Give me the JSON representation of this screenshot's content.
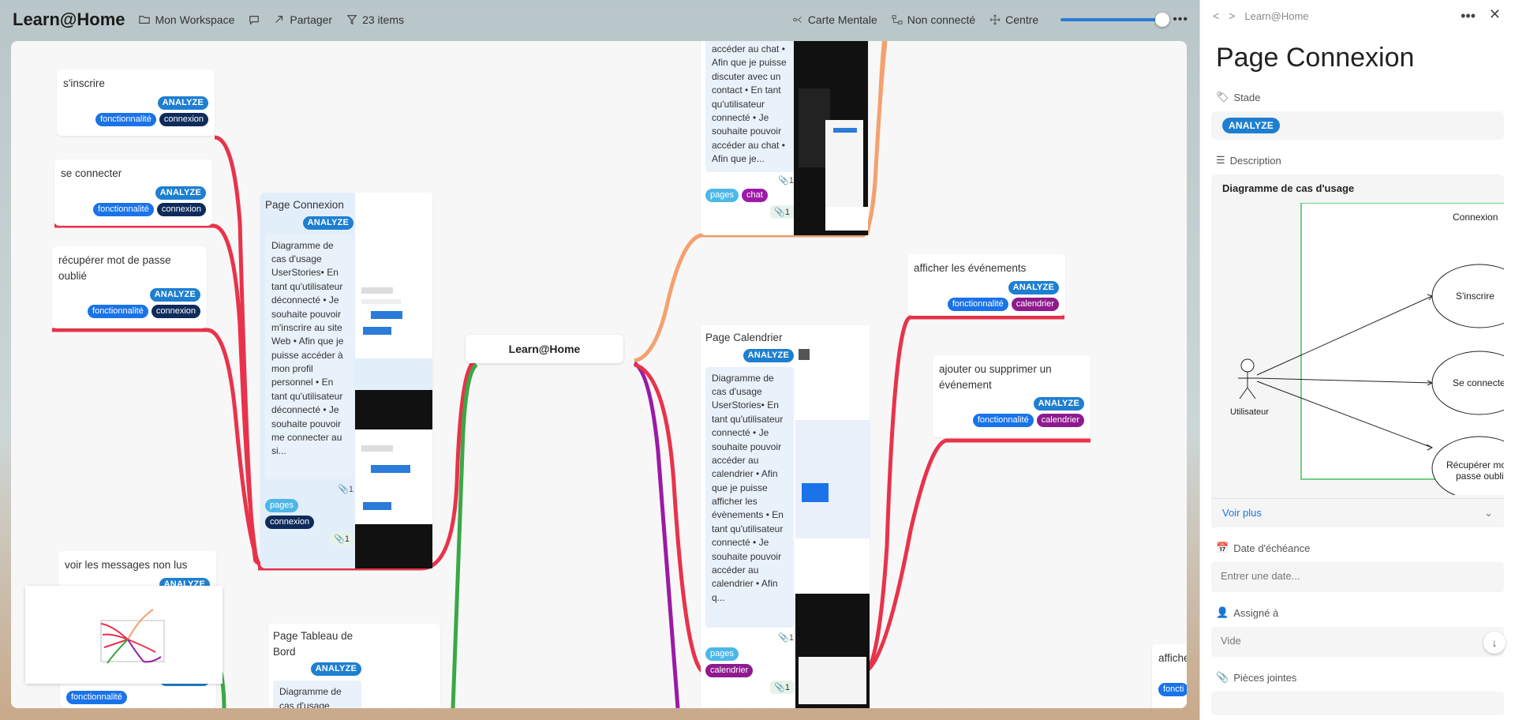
{
  "topbar": {
    "app_title": "Learn@Home",
    "workspace": "Mon Workspace",
    "share": "Partager",
    "items_count": "23 items",
    "view_mode": "Carte Mentale",
    "connection_status": "Non connecté",
    "center_label": "Centre",
    "zoom_level": 0.95
  },
  "mindmap": {
    "root": "Learn@Home",
    "nodes": {
      "inscrire": {
        "title": "s'inscrire",
        "stage": "ANALYZE",
        "tags": [
          "fonctionnalité",
          "connexion"
        ]
      },
      "connecter": {
        "title": "se connecter",
        "stage": "ANALYZE",
        "tags": [
          "fonctionnalité",
          "connexion"
        ]
      },
      "recuperer": {
        "title": "récupérer mot de passe oublié",
        "stage": "ANALYZE",
        "tags": [
          "fonctionnalité",
          "connexion"
        ]
      },
      "messages": {
        "title": "voir les messages non lus",
        "stage": "ANALYZE",
        "tags": [
          "fonctionnalité"
        ]
      },
      "page_connexion": {
        "title": "Page Connexion",
        "stage": "ANALYZE",
        "desc": "Diagramme de cas d'usage UserStories• En tant qu'utilisateur déconnecté • Je souhaite pouvoir m'inscrire au site Web • Afin que je puisse accéder à mon profil personnel • En tant qu'utilisateur déconnecté • Je souhaite pouvoir me connecter au si...",
        "attach": "1",
        "tags": [
          "pages",
          "connexion"
        ],
        "attach2": "1"
      },
      "page_tableau": {
        "title": "Page Tableau de Bord",
        "stage": "ANALYZE",
        "desc": "Diagramme de cas d'usage"
      },
      "page_chat": {
        "desc": "accéder au chat • Afin que je puisse discuter avec un contact • En tant qu'utilisateur connecté • Je souhaite pouvoir accéder au chat • Afin que je...",
        "attach": "1",
        "tags": [
          "pages",
          "chat"
        ],
        "attach2": "1"
      },
      "page_calendrier": {
        "title": "Page Calendrier",
        "stage": "ANALYZE",
        "desc": "Diagramme de cas d'usage UserStories• En tant qu'utilisateur connecté • Je souhaite pouvoir accéder au calendrier • Afin que je puisse afficher les évènements • En tant qu'utilisateur connecté • Je souhaite pouvoir accéder au calendrier • Afin q...",
        "attach": "1",
        "tags": [
          "pages",
          "calendrier"
        ],
        "attach2": "1"
      },
      "afficher_evt": {
        "title": "afficher les événements",
        "stage": "ANALYZE",
        "tags": [
          "fonctionnalité",
          "calendrier"
        ]
      },
      "ajouter_evt": {
        "title": "ajouter ou supprimer un événement",
        "stage": "ANALYZE",
        "tags": [
          "fonctionnalité",
          "calendrier"
        ]
      },
      "partial_right": {
        "title": "affiche",
        "tag": "foncti"
      }
    }
  },
  "panel": {
    "breadcrumb": "Learn@Home",
    "title": "Page Connexion",
    "stage_label": "Stade",
    "stage_value": "ANALYZE",
    "description_label": "Description",
    "description_heading": "Diagramme de cas d'usage",
    "diagram": {
      "system_name": "Connexion",
      "actor": "Utilisateur",
      "use_cases": [
        "S'inscrire",
        "Se connecte",
        "Récupérer mot",
        "passe oubli"
      ]
    },
    "see_more": "Voir plus",
    "due_date_label": "Date d'échéance",
    "due_date_placeholder": "Entrer une date...",
    "assigned_label": "Assigné à",
    "assigned_value": "Vide",
    "attachments_label": "Pièces jointes"
  },
  "colors": {
    "accent": "#1e7fd0",
    "link_red": "#e8334a",
    "link_green": "#3aa845",
    "link_purple": "#9a1aa6",
    "link_orange": "#f4a16e"
  }
}
